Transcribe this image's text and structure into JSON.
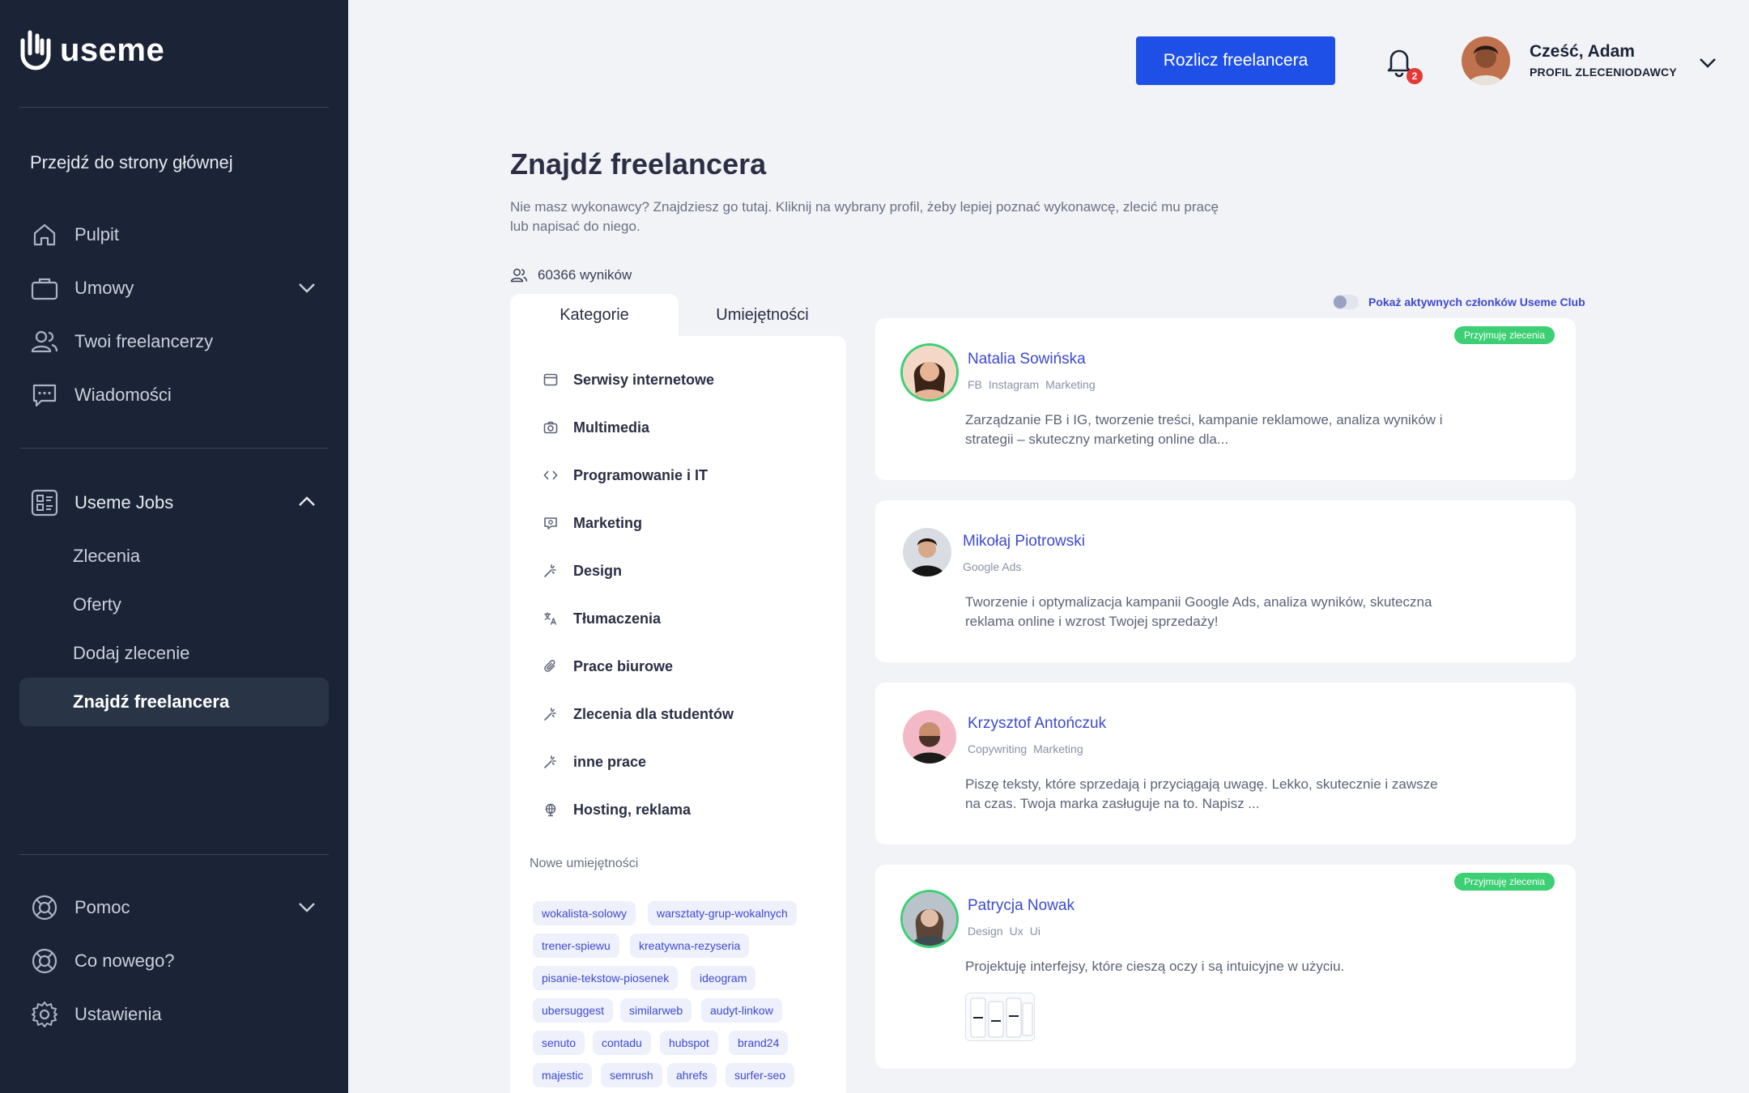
{
  "brand": {
    "name": "useme"
  },
  "sidebar": {
    "home_link": "Przejdź do strony głównej",
    "nav": [
      {
        "label": "Pulpit",
        "icon": "home-icon"
      },
      {
        "label": "Umowy",
        "icon": "briefcase-icon"
      },
      {
        "label": "Twoi freelancerzy",
        "icon": "users-icon"
      },
      {
        "label": "Wiadomości",
        "icon": "chat-icon"
      }
    ],
    "jobs": {
      "label": "Useme Jobs",
      "icon": "jobs-icon"
    },
    "jobs_items": [
      {
        "label": "Zlecenia"
      },
      {
        "label": "Oferty"
      },
      {
        "label": "Dodaj zlecenie"
      },
      {
        "label": "Znajdź freelancera",
        "active": true
      }
    ],
    "bottom": [
      {
        "label": "Pomoc",
        "icon": "lifebuoy-icon"
      },
      {
        "label": "Co nowego?",
        "icon": "lifebuoy-icon"
      },
      {
        "label": "Ustawienia",
        "icon": "gear-icon"
      }
    ]
  },
  "header": {
    "primary_button": "Rozlicz freelancera",
    "notifications_count": "2",
    "greeting": "Cześć, Adam",
    "role": "PROFIL ZLECENIODAWCY"
  },
  "main": {
    "title": "Znajdź freelancera",
    "description": "Nie masz wykonawcy? Znajdziesz go tutaj. Kliknij na wybrany profil, żeby lepiej poznać wykonawcę, zlecić mu pracę lub napisać do niego.",
    "results": "60366 wyników",
    "tabs": [
      "Kategorie",
      "Umiejętności"
    ],
    "categories": [
      "Serwisy internetowe",
      "Multimedia",
      "Programowanie i IT",
      "Marketing",
      "Design",
      "Tłumaczenia",
      "Prace biurowe",
      "Zlecenia dla studentów",
      "inne prace",
      "Hosting, reklama"
    ],
    "skills_title": "Nowe umiejętności",
    "skills": [
      "wokalista-solowy",
      "warsztaty-grup-wokalnych",
      "trener-spiewu",
      "kreatywna-rezyseria",
      "pisanie-tekstow-piosenek",
      "ideogram",
      "ubersuggest",
      "similarweb",
      "audyt-linkow",
      "senuto",
      "contadu",
      "hubspot",
      "brand24",
      "majestic",
      "semrush",
      "ahrefs",
      "surfer-seo"
    ],
    "toggle_label": "Pokaż aktywnych członków Useme Club",
    "badge_label": "Przyjmuję zlecenia",
    "freelancers": [
      {
        "name": "Natalia Sowińska",
        "tags": [
          "FB",
          "Instagram",
          "Marketing"
        ],
        "desc": "Zarządzanie FB i IG, tworzenie treści, kampanie reklamowe, analiza wyników i strategii – skuteczny marketing online dla...",
        "accepting": true
      },
      {
        "name": "Mikołaj Piotrowski",
        "tags": [
          "Google Ads"
        ],
        "desc": "Tworzenie i optymalizacja kampanii Google Ads, analiza wyników, skuteczna reklama online i wzrost Twojej sprzedaży!",
        "accepting": false
      },
      {
        "name": "Krzysztof Antończuk",
        "tags": [
          "Copywriting",
          "Marketing"
        ],
        "desc": "Piszę teksty, które sprzedają i przyciągają uwagę. Lekko, skutecznie i zawsze na czas. Twoja marka zasługuje na to. Napisz ...",
        "accepting": false
      },
      {
        "name": "Patrycja Nowak",
        "tags": [
          "Design",
          "Ux",
          "Ui"
        ],
        "desc": "Projektuję interfejsy, które cieszą oczy i są intuicyjne w użyciu.",
        "accepting": true
      }
    ]
  }
}
